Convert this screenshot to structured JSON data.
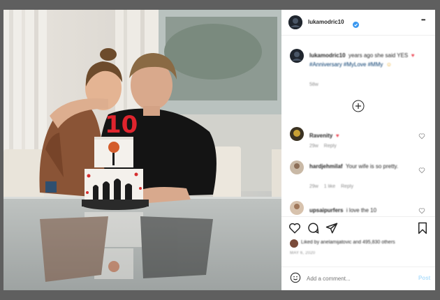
{
  "post": {
    "username": "lukamodric10",
    "more_label": "•••",
    "caption_lead": "years ago she said YES",
    "caption_tags": "#Anniversary #MyLove #MMy",
    "caption_age": "58w"
  },
  "comments": [
    {
      "user": "Ravenity",
      "text": "",
      "time": "29w",
      "reply": "Reply",
      "likes": ""
    },
    {
      "user": "hardjehmilaf",
      "text": "Your wife is so pretty.",
      "time": "29w",
      "likes": "1 like",
      "reply": "Reply"
    },
    {
      "user": "upsaipurfers",
      "text": "i love the 10",
      "time": "",
      "likes": "",
      "reply": ""
    }
  ],
  "likes_line": "Liked by anelamijatovic and 495,830 others",
  "post_date": "MAY 6, 2020",
  "comment_placeholder": "Add a comment...",
  "post_button": "Post",
  "cake_number": "10",
  "colors": {
    "verified": "#3897f0",
    "heart": "#ed4956",
    "link": "#00376b"
  },
  "icons": [
    "more-icon",
    "verified-badge-icon",
    "heart-icon",
    "comment-icon",
    "share-icon",
    "bookmark-icon",
    "emoji-icon",
    "plus-circle-icon"
  ]
}
